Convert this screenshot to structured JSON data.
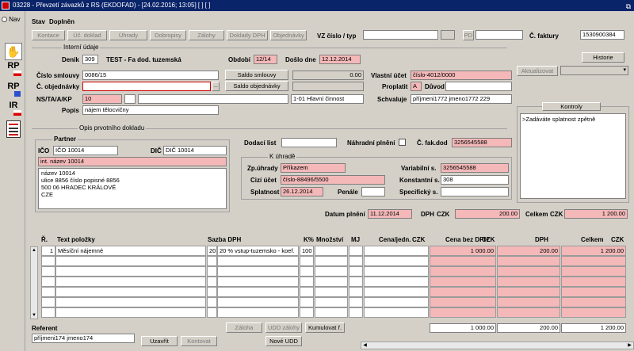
{
  "window": {
    "title": "03228 - Převzetí závazků z RS (EKDOFAD) - [24.02.2016; 13:05] [ ] [ ]",
    "nav_label": "Nav"
  },
  "side_tiles": [
    {
      "label": "RP"
    },
    {
      "label": "RP"
    },
    {
      "label": "IR"
    }
  ],
  "header": {
    "stav_label": "Stav",
    "stav_value": "Doplněn",
    "tabs": [
      "Kontace",
      "Úč. doklad",
      "Úhrady",
      "Dobropisy",
      "Zálohy",
      "Doklady DPH",
      "Objednávky"
    ],
    "vz_label": "VZ číslo / typ",
    "pd_label": "PD",
    "faktura_label": "Č. faktury",
    "faktura_value": "1530900384"
  },
  "interni": {
    "section_label": "Interní údaje",
    "denik_label": "Deník",
    "denik_value": "309",
    "denik_text": "TEST - Fa dod. tuzemská",
    "obdobi_label": "Období",
    "obdobi_value": "12/14",
    "doslo_label": "Došlo dne",
    "doslo_value": "12.12.2014",
    "smlouva_label": "Číslo smlouvy",
    "smlouva_value": "0086/15",
    "saldo_smlouvy_btn": "Saldo smlouvy",
    "saldo_smlouvy_value": "0.00",
    "objednavka_label": "Č. objednávky",
    "saldo_objednavky_btn": "Saldo objednávky",
    "ns_label": "NS/TA/A/KP",
    "ns_value": "10",
    "ns_text": "1-01 Hlavní činnost",
    "popis_label": "Popis",
    "popis_value": "nájem tělocvičny",
    "vlastni_ucet_label": "Vlastní účet",
    "vlastni_ucet_value": "číslo-4012/0000",
    "proplatit_label": "Proplatit",
    "proplatit_value": "A",
    "duvod_label": "Důvod",
    "schvaluje_label": "Schvaluje",
    "schvaluje_value": "příjmeni1772 jmeno1772 229",
    "historie_btn": "Historie",
    "aktualizovat_btn": "Aktualizovat"
  },
  "kontroly": {
    "btn": "Kontroly",
    "text": ">Zadáváte splatnost zpětně"
  },
  "opis": {
    "section_label": "Opis prvotního dokladu",
    "partner_label": "Partner",
    "ico_label": "IČO",
    "ico_value": "IČO 10014",
    "dic_label": "DIČ",
    "dic_value": "DIČ 10014",
    "int_nazev": "int. název 10014",
    "address": [
      "název 10014",
      "ulice 8856 číslo popisné 8856",
      "500 06 HRADEC KRÁLOVÉ",
      "CZE"
    ],
    "dodaci_label": "Dodací list",
    "nahradni_label": "Náhradní plnění",
    "fak_dod_label": "Č. fak.dod",
    "fak_dod_value": "3256545588"
  },
  "k_uhrade": {
    "section_label": "K úhradě",
    "zp_uhrady_label": "Zp.úhrady",
    "zp_uhrady_value": "Příkazem",
    "cizi_ucet_label": "Cizí účet",
    "cizi_ucet_value": "číslo-88496/5500",
    "splatnost_label": "Splatnost",
    "splatnost_value": "26.12.2014",
    "penale_label": "Penále",
    "variabilni_label": "Variabilní s.",
    "variabilni_value": "3256545588",
    "konstantni_label": "Konstantní s.",
    "konstantni_value": "308",
    "specificky_label": "Specifický s."
  },
  "totals": {
    "datum_plneni_label": "Datum plnění",
    "datum_plneni_value": "11.12.2014",
    "dph_label": "DPH",
    "currency": "CZK",
    "dph_value": "200.00",
    "celkem_label": "Celkem",
    "celkem_value": "1 200.00"
  },
  "table": {
    "headers": {
      "r": "Ř.",
      "text": "Text položky",
      "sazba": "Sazba DPH",
      "kproc": "K%",
      "mnozstvi": "Množství",
      "mj": "MJ",
      "cena_jedn": "Cena/jedn.",
      "cena_bez": "Cena bez DPH",
      "dph": "DPH",
      "celkem": "Celkem",
      "czk": "CZK"
    },
    "rows": [
      {
        "r": "1",
        "text": "Měsíční nájemné",
        "sazba_code": "20",
        "sazba_text": "20 % vstup-tuzemsko - koef.",
        "kproc": "100",
        "mnozstvi": "",
        "mj": "",
        "cena_jedn": "",
        "cena_bez": "1 000.00",
        "dph": "200.00",
        "celkem": "1 200.00"
      }
    ],
    "sum_cena_bez": "1 000.00",
    "sum_dph": "200.00",
    "sum_celkem": "1 200.00"
  },
  "footer": {
    "referent_label": "Referent",
    "referent_value": "příjmeni174 jmeno174",
    "uzavrit_btn": "Uzavřít",
    "kontovat_btn": "Kontovat",
    "zaloha_btn": "Záloha",
    "udd_zalohy_btn": "UDD zálohy",
    "kumulovat_btn": "Kumulovat ř.",
    "nove_udd_btn": "Nové UDD"
  }
}
